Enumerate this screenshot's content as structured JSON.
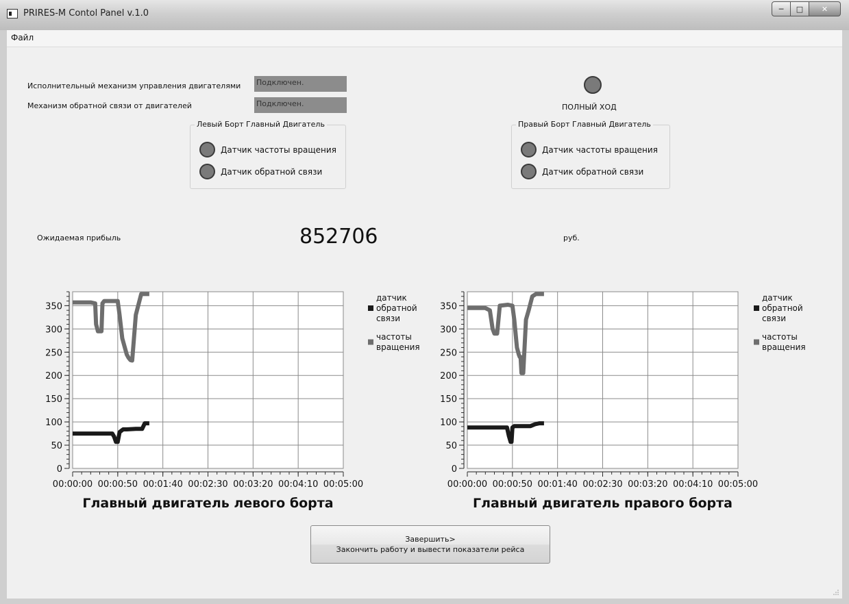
{
  "window": {
    "title": "PRIRES-M Contol Panel v.1.0",
    "icon": "app-window-icon"
  },
  "menu": {
    "items": [
      "Файл"
    ]
  },
  "status": {
    "actuator_label": "Исполнительный механизм управления двигателями",
    "actuator_value": "Подключен.",
    "feedback_label": "Механизм обратной связи от двигателей",
    "feedback_value": "Подключен.",
    "mode_text": "ПОЛНЫЙ ХОД"
  },
  "left_group": {
    "title": "Левый Борт Главный Двигатель",
    "sensor1": "Датчик частоты вращения",
    "sensor2": "Датчик обратной связи"
  },
  "right_group": {
    "title": "Правый  Борт Главный Двигатель",
    "sensor1": "Датчик частоты вращения",
    "sensor2": "Датчик обратной связи"
  },
  "profit": {
    "label": "Ожидаемая прибыль",
    "value": "852706",
    "unit": "руб."
  },
  "button": {
    "line1": "Завершить>",
    "line2": "Закончить работу и вывести показатели рейса"
  },
  "colors": {
    "feedback_series": "#1a1a1a",
    "rpm_series": "#6e6e6e",
    "status_field": "#8c8c8c",
    "led": "#7a7a7a"
  },
  "chart_data": [
    {
      "type": "line",
      "title": "Главный двигатель левого борта",
      "x_ticks": [
        "00:00:00",
        "00:00:50",
        "00:01:40",
        "00:02:30",
        "00:03:20",
        "00:04:10",
        "00:05:00"
      ],
      "xlim": [
        0,
        300
      ],
      "y_ticks": [
        0,
        50,
        100,
        150,
        200,
        250,
        300,
        350
      ],
      "ylim": [
        0,
        380
      ],
      "grid": true,
      "legend_position": "right",
      "series": [
        {
          "name": "датчик обратной связи",
          "color": "#1a1a1a",
          "x": [
            0,
            20,
            40,
            44,
            46,
            48,
            50,
            52,
            56,
            60,
            70,
            77,
            80,
            85
          ],
          "y": [
            75,
            75,
            75,
            75,
            68,
            57,
            57,
            78,
            84,
            84,
            85,
            85,
            97,
            97
          ]
        },
        {
          "name": "частоты вращения",
          "color": "#6e6e6e",
          "x": [
            0,
            20,
            25,
            26,
            28,
            32,
            33,
            35,
            50,
            52,
            55,
            60,
            62,
            64,
            66,
            68,
            70,
            72,
            76,
            80,
            85
          ],
          "y": [
            357,
            357,
            355,
            310,
            295,
            295,
            355,
            360,
            360,
            330,
            280,
            245,
            238,
            233,
            232,
            280,
            330,
            345,
            375,
            375,
            375
          ]
        }
      ]
    },
    {
      "type": "line",
      "title": "Главный двигатель правого борта",
      "x_ticks": [
        "00:00:00",
        "00:00:50",
        "00:01:40",
        "00:02:30",
        "00:03:20",
        "00:04:10",
        "00:05:00"
      ],
      "xlim": [
        0,
        300
      ],
      "y_ticks": [
        0,
        50,
        100,
        150,
        200,
        250,
        300,
        350
      ],
      "ylim": [
        0,
        380
      ],
      "grid": true,
      "legend_position": "right",
      "series": [
        {
          "name": "датчик обратной связи",
          "color": "#1a1a1a",
          "x": [
            0,
            20,
            40,
            44,
            46,
            48,
            49,
            50,
            52,
            70,
            75,
            80,
            85
          ],
          "y": [
            88,
            88,
            88,
            88,
            70,
            57,
            57,
            88,
            91,
            91,
            95,
            97,
            97
          ]
        },
        {
          "name": "частоты вращения",
          "color": "#6e6e6e",
          "x": [
            0,
            20,
            25,
            28,
            30,
            33,
            36,
            45,
            50,
            52,
            55,
            57,
            58,
            59,
            60,
            62,
            65,
            68,
            72,
            76,
            80,
            85
          ],
          "y": [
            345,
            345,
            340,
            300,
            290,
            290,
            350,
            352,
            350,
            320,
            260,
            245,
            240,
            240,
            205,
            205,
            320,
            340,
            370,
            375,
            375,
            375
          ]
        }
      ]
    }
  ]
}
